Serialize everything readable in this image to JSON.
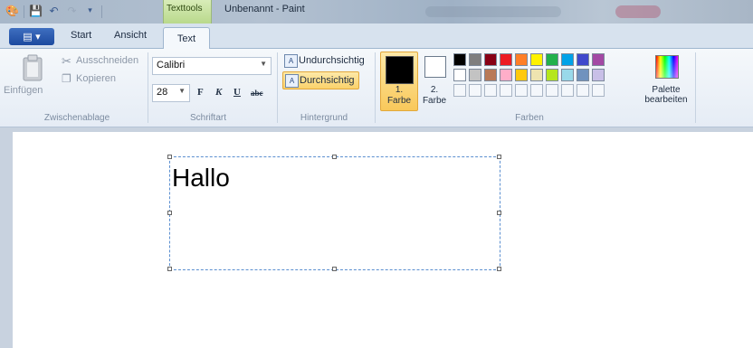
{
  "titlebar": {
    "context_group": "Texttools",
    "window_title": "Unbenannt - Paint"
  },
  "tabs": {
    "file_menu_icon": "paint-menu-icon",
    "start": "Start",
    "view": "Ansicht",
    "text": "Text"
  },
  "clipboard": {
    "paste": "Einfügen",
    "cut": "Ausschneiden",
    "copy": "Kopieren",
    "group_label": "Zwischenablage"
  },
  "font": {
    "family": "Calibri",
    "size": "28",
    "bold": "F",
    "italic": "K",
    "underline": "U",
    "strikethrough": "abc",
    "group_label": "Schriftart"
  },
  "background": {
    "opaque": "Undurchsichtig",
    "transparent": "Durchsichtig",
    "selected": "Durchsichtig",
    "group_label": "Hintergrund"
  },
  "colors": {
    "color1_label_a": "1.",
    "color1_label_b": "Farbe",
    "color2_label_a": "2.",
    "color2_label_b": "Farbe",
    "color1": "#000000",
    "color2": "#ffffff",
    "group_label": "Farben",
    "edit_palette_a": "Palette",
    "edit_palette_b": "bearbeiten",
    "palette_row1": [
      "#000000",
      "#7f7f7f",
      "#880015",
      "#ed1c24",
      "#ff7f27",
      "#fff200",
      "#22b14c",
      "#00a2e8",
      "#3f48cc",
      "#a349a4"
    ],
    "palette_row2": [
      "#ffffff",
      "#c3c3c3",
      "#b97a57",
      "#ffaec9",
      "#ffc90e",
      "#efe4b0",
      "#b5e61d",
      "#99d9ea",
      "#7092be",
      "#c8bfe7"
    ]
  },
  "canvas": {
    "text": "Hallo"
  }
}
